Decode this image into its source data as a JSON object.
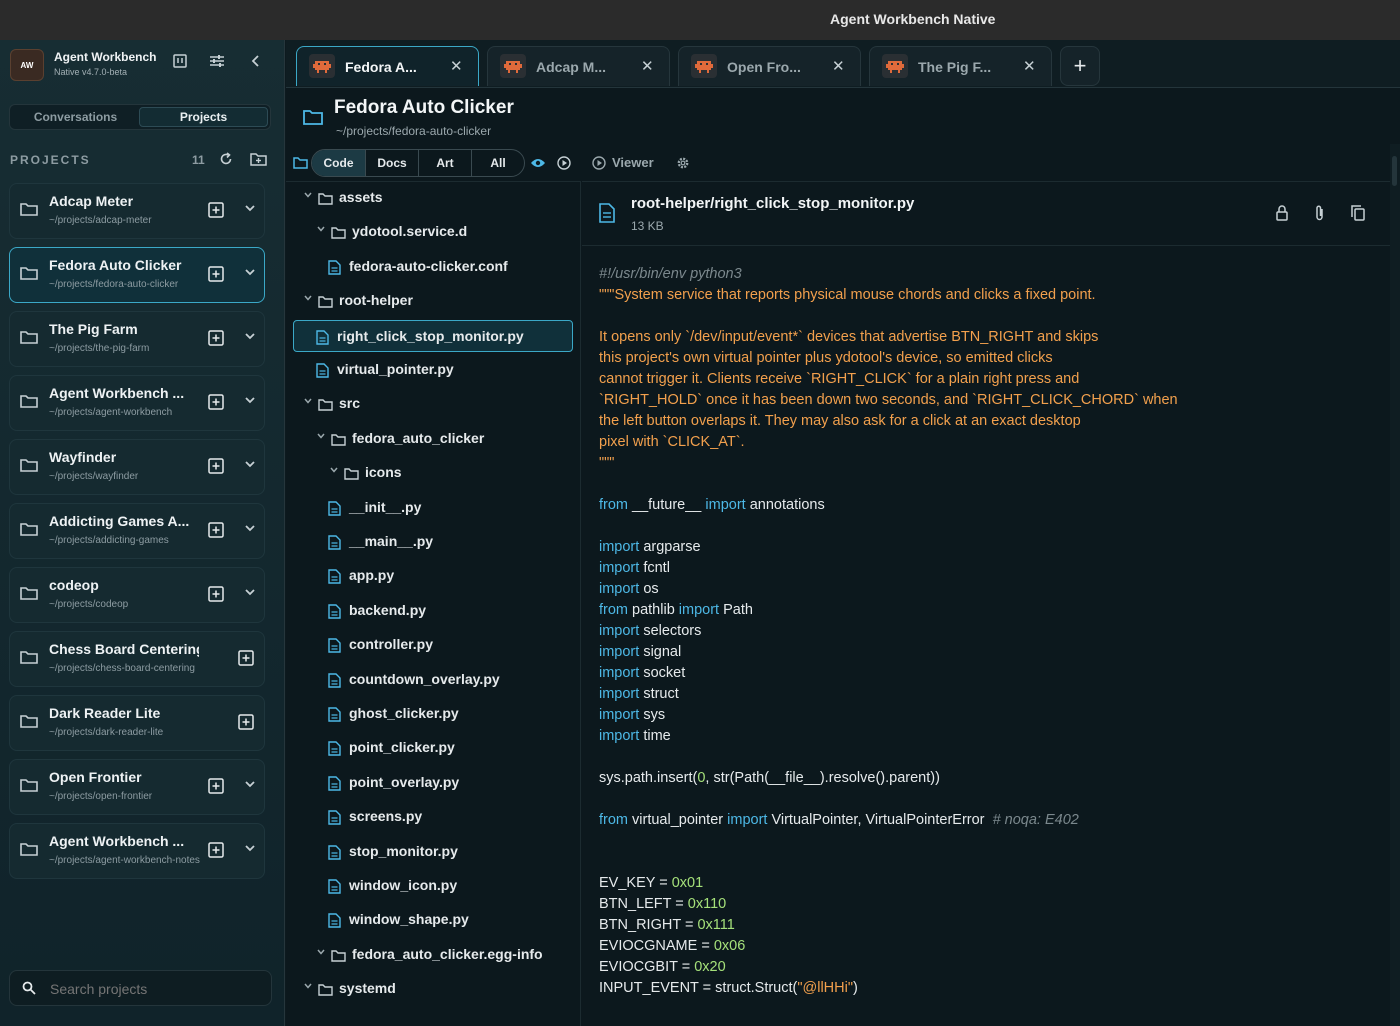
{
  "window": {
    "title": "Agent Workbench Native"
  },
  "sidebar": {
    "brand_mark": "AW",
    "brand_title": "Agent Workbench",
    "brand_version": "Native v4.7.0-beta",
    "segments": [
      {
        "label": "Conversations",
        "active": false
      },
      {
        "label": "Projects",
        "active": true
      }
    ],
    "projects_heading": "PROJECTS",
    "projects_count": "11",
    "projects": [
      {
        "name": "Adcap Meter",
        "path": "~/projects/adcap-meter",
        "selected": false,
        "chevron": true
      },
      {
        "name": "Fedora Auto Clicker",
        "path": "~/projects/fedora-auto-clicker",
        "selected": true,
        "chevron": true
      },
      {
        "name": "The Pig Farm",
        "path": "~/projects/the-pig-farm",
        "selected": false,
        "chevron": true
      },
      {
        "name": "Agent Workbench ...",
        "path": "~/projects/agent-workbench",
        "selected": false,
        "chevron": true
      },
      {
        "name": "Wayfinder",
        "path": "~/projects/wayfinder",
        "selected": false,
        "chevron": true
      },
      {
        "name": "Addicting Games A...",
        "path": "~/projects/addicting-games",
        "selected": false,
        "chevron": true
      },
      {
        "name": "codeop",
        "path": "~/projects/codeop",
        "selected": false,
        "chevron": true
      },
      {
        "name": "Chess Board Centering",
        "path": "~/projects/chess-board-centering",
        "selected": false,
        "chevron": false
      },
      {
        "name": "Dark Reader Lite",
        "path": "~/projects/dark-reader-lite",
        "selected": false,
        "chevron": false
      },
      {
        "name": "Open Frontier",
        "path": "~/projects/open-frontier",
        "selected": false,
        "chevron": true
      },
      {
        "name": "Agent Workbench ...",
        "path": "~/projects/agent-workbench-notes",
        "selected": false,
        "chevron": true
      }
    ],
    "search_placeholder": "Search projects"
  },
  "tabs": [
    {
      "label": "Fedora A...",
      "active": true
    },
    {
      "label": "Adcap M...",
      "active": false
    },
    {
      "label": "Open Fro...",
      "active": false
    },
    {
      "label": "The Pig F...",
      "active": false
    }
  ],
  "project": {
    "title": "Fedora Auto Clicker",
    "path": "~/projects/fedora-auto-clicker"
  },
  "filters": [
    {
      "label": "Code",
      "active": true
    },
    {
      "label": "Docs",
      "active": false
    },
    {
      "label": "Art",
      "active": false
    },
    {
      "label": "All",
      "active": false
    }
  ],
  "viewer_label": "Viewer",
  "tree": [
    {
      "name": "assets",
      "type": "folder",
      "depth": 0,
      "expanded": true
    },
    {
      "name": "ydotool.service.d",
      "type": "folder",
      "depth": 1,
      "expanded": true
    },
    {
      "name": "fedora-auto-clicker.conf",
      "type": "file",
      "depth": 2
    },
    {
      "name": "root-helper",
      "type": "folder",
      "depth": 0,
      "expanded": true
    },
    {
      "name": "right_click_stop_monitor.py",
      "type": "file",
      "depth": 1,
      "selected": true
    },
    {
      "name": "virtual_pointer.py",
      "type": "file",
      "depth": 1
    },
    {
      "name": "src",
      "type": "folder",
      "depth": 0,
      "expanded": true
    },
    {
      "name": "fedora_auto_clicker",
      "type": "folder",
      "depth": 1,
      "expanded": true
    },
    {
      "name": "icons",
      "type": "folder",
      "depth": 2,
      "expanded": true
    },
    {
      "name": "__init__.py",
      "type": "file",
      "depth": 2
    },
    {
      "name": "__main__.py",
      "type": "file",
      "depth": 2
    },
    {
      "name": "app.py",
      "type": "file",
      "depth": 2
    },
    {
      "name": "backend.py",
      "type": "file",
      "depth": 2
    },
    {
      "name": "controller.py",
      "type": "file",
      "depth": 2
    },
    {
      "name": "countdown_overlay.py",
      "type": "file",
      "depth": 2
    },
    {
      "name": "ghost_clicker.py",
      "type": "file",
      "depth": 2
    },
    {
      "name": "point_clicker.py",
      "type": "file",
      "depth": 2
    },
    {
      "name": "point_overlay.py",
      "type": "file",
      "depth": 2
    },
    {
      "name": "screens.py",
      "type": "file",
      "depth": 2
    },
    {
      "name": "stop_monitor.py",
      "type": "file",
      "depth": 2
    },
    {
      "name": "window_icon.py",
      "type": "file",
      "depth": 2
    },
    {
      "name": "window_shape.py",
      "type": "file",
      "depth": 2
    },
    {
      "name": "fedora_auto_clicker.egg-info",
      "type": "folder",
      "depth": 1,
      "expanded": true
    },
    {
      "name": "systemd",
      "type": "folder",
      "depth": 0,
      "expanded": true
    }
  ],
  "file": {
    "name": "root-helper/right_click_stop_monitor.py",
    "size": "13 KB"
  },
  "code_lines": [
    [
      [
        "cm",
        "#!/usr/bin/env python3"
      ]
    ],
    [
      [
        "st",
        "\"\"\"System service that reports physical mouse chords and clicks a fixed point."
      ]
    ],
    [],
    [
      [
        "st",
        "It opens only `/dev/input/event*` devices that advertise BTN_RIGHT and skips"
      ]
    ],
    [
      [
        "st",
        "this project's own virtual pointer plus ydotool's device, so emitted clicks"
      ]
    ],
    [
      [
        "st",
        "cannot trigger it. Clients receive `RIGHT_CLICK` for a plain right press and"
      ]
    ],
    [
      [
        "st",
        "`RIGHT_HOLD` once it has been down two seconds, and `RIGHT_CLICK_CHORD` when"
      ]
    ],
    [
      [
        "st",
        "the left button overlaps it. They may also ask for a click at an exact desktop"
      ]
    ],
    [
      [
        "st",
        "pixel with `CLICK_AT`."
      ]
    ],
    [
      [
        "st",
        "\"\"\""
      ]
    ],
    [],
    [
      [
        "kw",
        "from"
      ],
      [
        "tx",
        " __future__ "
      ],
      [
        "kw",
        "import"
      ],
      [
        "tx",
        " annotations"
      ]
    ],
    [],
    [
      [
        "kw",
        "import"
      ],
      [
        "tx",
        " argparse"
      ]
    ],
    [
      [
        "kw",
        "import"
      ],
      [
        "tx",
        " fcntl"
      ]
    ],
    [
      [
        "kw",
        "import"
      ],
      [
        "tx",
        " os"
      ]
    ],
    [
      [
        "kw",
        "from"
      ],
      [
        "tx",
        " pathlib "
      ],
      [
        "kw",
        "import"
      ],
      [
        "tx",
        " Path"
      ]
    ],
    [
      [
        "kw",
        "import"
      ],
      [
        "tx",
        " selectors"
      ]
    ],
    [
      [
        "kw",
        "import"
      ],
      [
        "tx",
        " signal"
      ]
    ],
    [
      [
        "kw",
        "import"
      ],
      [
        "tx",
        " socket"
      ]
    ],
    [
      [
        "kw",
        "import"
      ],
      [
        "tx",
        " struct"
      ]
    ],
    [
      [
        "kw",
        "import"
      ],
      [
        "tx",
        " sys"
      ]
    ],
    [
      [
        "kw",
        "import"
      ],
      [
        "tx",
        " time"
      ]
    ],
    [],
    [
      [
        "tx",
        "sys.path.insert("
      ],
      [
        "nu",
        "0"
      ],
      [
        "tx",
        ", str(Path(__file__).resolve().parent))"
      ]
    ],
    [],
    [
      [
        "kw",
        "from"
      ],
      [
        "tx",
        " virtual_pointer "
      ],
      [
        "kw",
        "import"
      ],
      [
        "tx",
        " VirtualPointer, VirtualPointerError  "
      ],
      [
        "cm",
        "# noqa: E402"
      ]
    ],
    [],
    [],
    [
      [
        "tx",
        "EV_KEY = "
      ],
      [
        "nu",
        "0x01"
      ]
    ],
    [
      [
        "tx",
        "BTN_LEFT = "
      ],
      [
        "nu",
        "0x110"
      ]
    ],
    [
      [
        "tx",
        "BTN_RIGHT = "
      ],
      [
        "nu",
        "0x111"
      ]
    ],
    [
      [
        "tx",
        "EVIOCGNAME = "
      ],
      [
        "nu",
        "0x06"
      ]
    ],
    [
      [
        "tx",
        "EVIOCGBIT = "
      ],
      [
        "nu",
        "0x20"
      ]
    ],
    [
      [
        "tx",
        "INPUT_EVENT = struct.Struct("
      ],
      [
        "st",
        "\"@llHHi\""
      ],
      [
        "tx",
        ")"
      ]
    ]
  ]
}
